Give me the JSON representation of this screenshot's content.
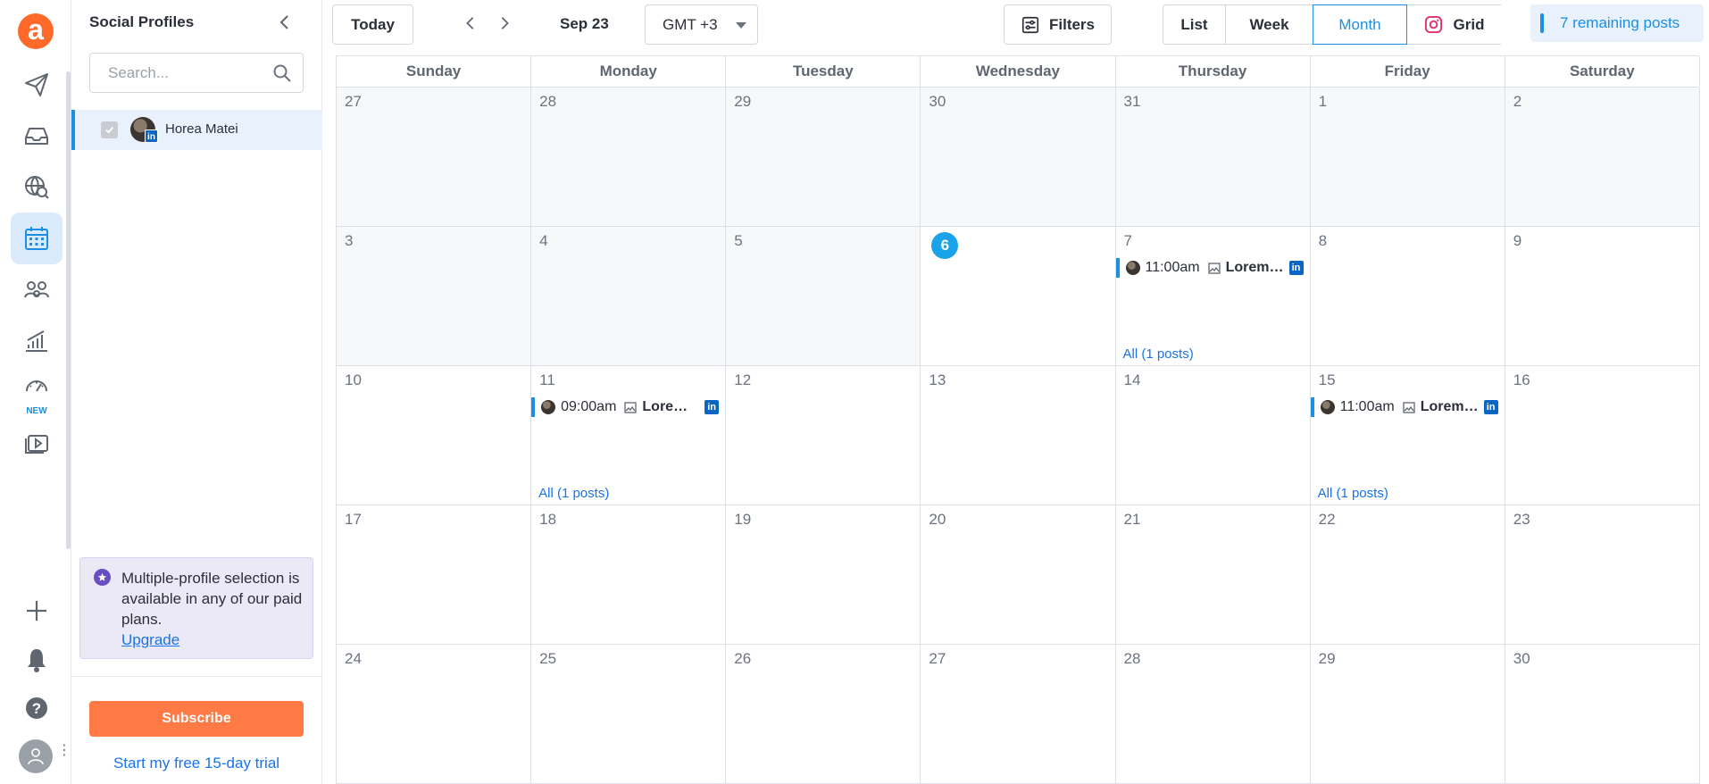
{
  "app": {
    "logo_letter": "a",
    "brand_color": "#ff6a2b",
    "accent_color": "#1a8fe3"
  },
  "rail": {
    "items": [
      {
        "icon": "paper-plane-icon"
      },
      {
        "icon": "inbox-icon"
      },
      {
        "icon": "globe-search-icon"
      },
      {
        "icon": "calendar-icon",
        "active": true
      },
      {
        "icon": "team-icon"
      },
      {
        "icon": "analytics-icon"
      },
      {
        "icon": "dashboard-gauge-icon",
        "tag": "NEW"
      },
      {
        "icon": "media-library-icon"
      }
    ],
    "new_tag": "NEW",
    "bottom": [
      "plus-icon",
      "bell-icon",
      "help-icon",
      "user-avatar-icon"
    ]
  },
  "panel": {
    "title": "Social Profiles",
    "search_placeholder": "Search...",
    "profile": {
      "name": "Horea Matei",
      "network": "in"
    },
    "upgrade": {
      "text": "Multiple-profile selection is available in any of our paid plans.",
      "link": "Upgrade"
    },
    "subscribe_label": "Subscribe",
    "trial_label": "Start my free 15-day trial"
  },
  "toolbar": {
    "today_label": "Today",
    "current_date": "Sep 23",
    "timezone": "GMT +3",
    "filters_label": "Filters",
    "views": {
      "list": "List",
      "week": "Week",
      "month": "Month",
      "grid": "Grid"
    },
    "selected_view": "Month",
    "remaining_posts": "7 remaining posts"
  },
  "calendar": {
    "weekdays": [
      "Sunday",
      "Monday",
      "Tuesday",
      "Wednesday",
      "Thursday",
      "Friday",
      "Saturday"
    ],
    "today": "6",
    "all_posts_label": "All (1 posts)",
    "weeks": [
      [
        "27",
        "28",
        "29",
        "30",
        "31",
        "1",
        "2"
      ],
      [
        "3",
        "4",
        "5",
        "6",
        "7",
        "8",
        "9"
      ],
      [
        "10",
        "11",
        "12",
        "13",
        "14",
        "15",
        "16"
      ],
      [
        "17",
        "18",
        "19",
        "20",
        "21",
        "22",
        "23"
      ],
      [
        "24",
        "25",
        "26",
        "27",
        "28",
        "29",
        "30"
      ]
    ],
    "posts": [
      {
        "day": "7",
        "time": "11:00am",
        "title": "Lorem ip...",
        "network": "in"
      },
      {
        "day": "11",
        "time": "09:00am",
        "title": "Lorem i...",
        "network": "in"
      },
      {
        "day": "15",
        "time": "11:00am",
        "title": "Lorem ip...",
        "network": "in"
      }
    ]
  }
}
